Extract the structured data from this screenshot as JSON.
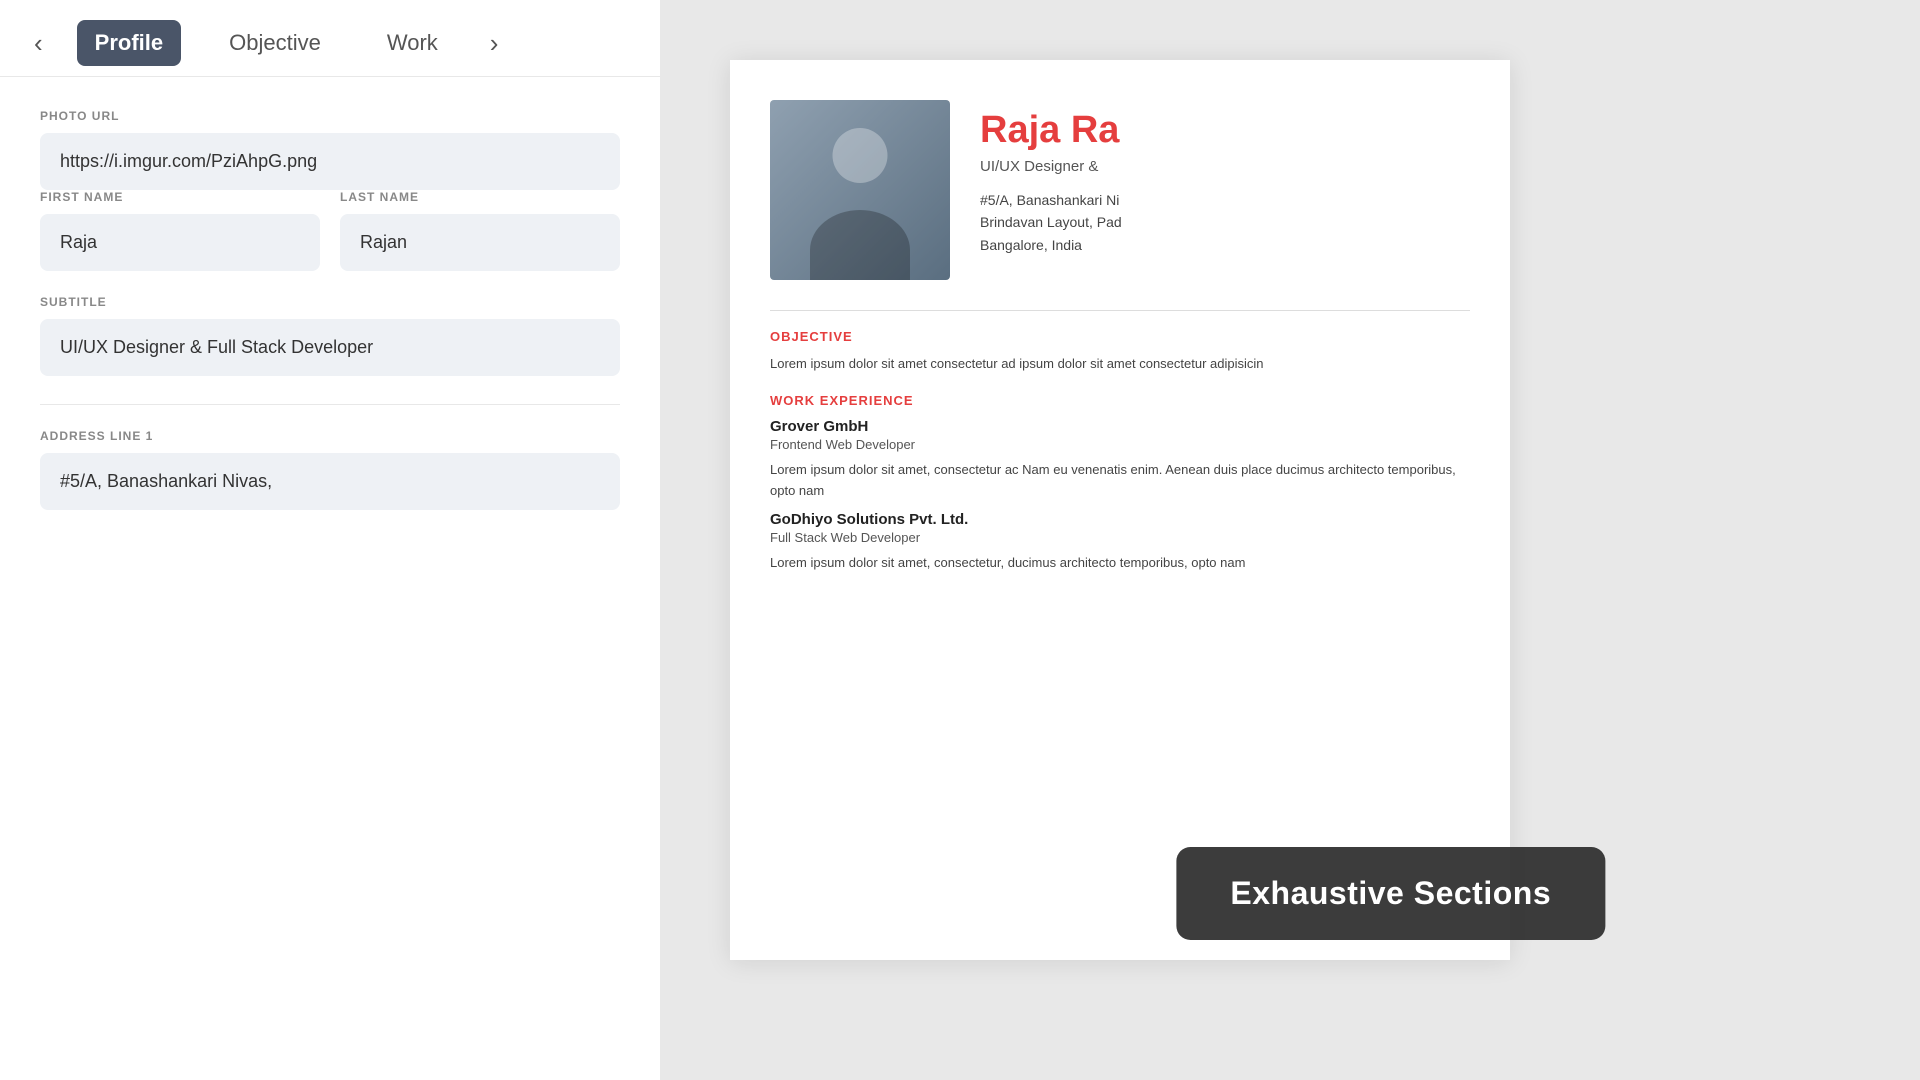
{
  "tabs": {
    "prev_btn": "‹",
    "next_btn": "›",
    "items": [
      {
        "id": "profile",
        "label": "Profile",
        "active": true
      },
      {
        "id": "objective",
        "label": "Objective",
        "active": false
      },
      {
        "id": "work",
        "label": "Work",
        "active": false
      }
    ]
  },
  "form": {
    "photo_url_label": "PHOTO URL",
    "photo_url_value": "https://i.imgur.com/PziAhpG.png",
    "first_name_label": "FIRST NAME",
    "first_name_value": "Raja",
    "last_name_label": "LAST NAME",
    "last_name_value": "Rajan",
    "subtitle_label": "SUBTITLE",
    "subtitle_value": "UI/UX Designer & Full Stack Developer",
    "address_label": "ADDRESS LINE 1",
    "address_value": "#5/A, Banashankari Nivas,"
  },
  "resume": {
    "name": "Raja Ra",
    "subtitle": "UI/UX Designer &",
    "address_line1": "#5/A, Banashankari Ni",
    "address_line2": "Brindavan Layout, Pad",
    "address_line3": "Bangalore, India",
    "objective_title": "OBJECTIVE",
    "objective_text": "Lorem ipsum dolor sit amet consectetur ad ipsum dolor sit amet consectetur adipisicin",
    "work_title": "WORK EXPERIENCE",
    "jobs": [
      {
        "company": "Grover GmbH",
        "role": "Frontend Web Developer",
        "description": "Lorem ipsum dolor sit amet, consectetur ac Nam eu venenatis enim. Aenean duis place ducimus architecto temporibus, opto nam"
      },
      {
        "company": "GoDhiyo Solutions Pvt. Ltd.",
        "role": "Full Stack Web Developer",
        "description": "Lorem ipsum dolor sit amet, consectetur, ducimus architecto temporibus, opto nam"
      }
    ]
  },
  "toast": {
    "text": "Exhaustive Sections"
  }
}
